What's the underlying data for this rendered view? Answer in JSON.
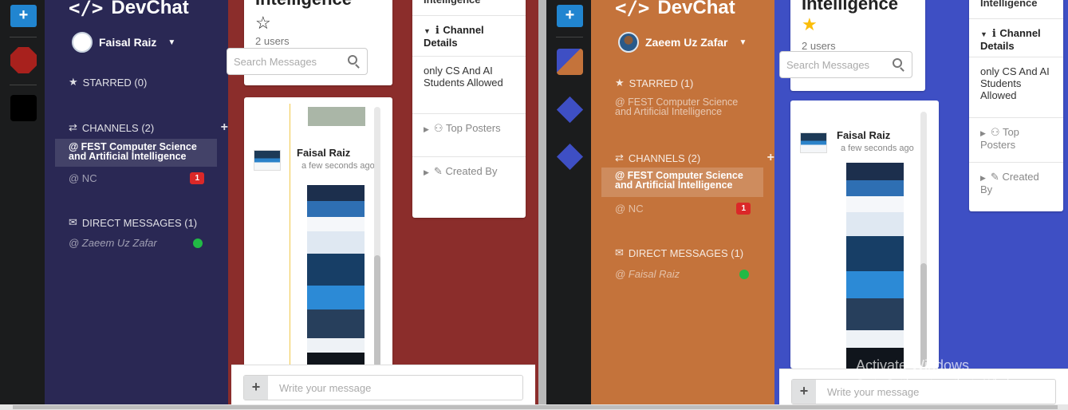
{
  "colors": {
    "rail": "#1b1c1d",
    "accent": "#2185d0",
    "sidebar_a": "#2a2854",
    "main_a": "#8b2d2b",
    "sidebar_b": "#c4733b",
    "main_b": "#3e4fc4",
    "badge": "#db2828",
    "online": "#21ba45",
    "star_gold": "#fbbd08"
  },
  "panes": [
    {
      "app_name": "DevChat",
      "user_name": "Faisal Raiz",
      "starred_label": "STARRED (0)",
      "starred_items": [],
      "channels_label": "CHANNELS (2)",
      "channels": [
        {
          "name": "@ FEST Computer Science and Artificial Intelligence",
          "active": true
        },
        {
          "name": "@ NC",
          "unread": "1"
        }
      ],
      "dm_label": "DIRECT MESSAGES (1)",
      "dms": [
        {
          "name": "@ Zaeem Uz Zafar",
          "online": true
        }
      ],
      "channel_title": "Intelligence",
      "star_icon": "star-outline-icon",
      "users_count": "2 users",
      "search_placeholder": "Search Messages",
      "message_author": "Faisal Raiz",
      "message_time": "a few seconds ago",
      "details_title_top": "Intelligence",
      "details_header": "Channel Details",
      "details_text": "only CS And AI Students Allowed",
      "top_posters": "Top Posters",
      "created_by": "Created By",
      "composer_placeholder": "Write your message"
    },
    {
      "app_name": "DevChat",
      "user_name": "Zaeem Uz Zafar",
      "starred_label": "STARRED (1)",
      "starred_items": [
        "@ FEST Computer Science and Artificial Intelligence"
      ],
      "channels_label": "CHANNELS (2)",
      "channels": [
        {
          "name": "@ FEST Computer Science and Artificial Intelligence",
          "active": true
        },
        {
          "name": "@ NC",
          "unread": "1"
        }
      ],
      "dm_label": "DIRECT MESSAGES (1)",
      "dms": [
        {
          "name": "@ Faisal Raiz",
          "online": true
        }
      ],
      "channel_title": "Intelligence",
      "star_icon": "star-filled-icon",
      "users_count": "2 users",
      "search_placeholder": "Search Messages",
      "message_author": "Faisal Raiz",
      "message_time": "a few seconds ago",
      "details_title_top": "Intelligence",
      "details_header": "Channel Details",
      "details_text": "only CS And AI Students Allowed",
      "top_posters": "Top Posters",
      "created_by": "Created By",
      "composer_placeholder": "Write your message"
    }
  ],
  "watermark": {
    "title": "Activate Windows",
    "subtitle": "Go to Settings to activate Windows."
  }
}
